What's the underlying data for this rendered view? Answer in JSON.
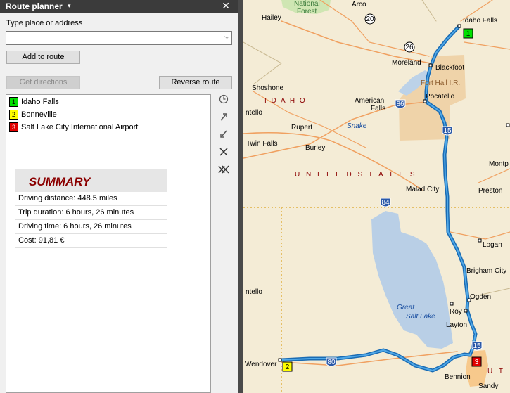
{
  "panel": {
    "title": "Route planner",
    "menu_arrow": "▾",
    "close_symbol": "✕",
    "place_label": "Type place or address",
    "place_value": "",
    "add_to_route_label": "Add to route",
    "get_directions_label": "Get directions",
    "reverse_route_label": "Reverse route"
  },
  "waypoints": [
    {
      "number": "1",
      "name": "Idaho Falls",
      "color": "#00e000"
    },
    {
      "number": "2",
      "name": "Bonneville",
      "color": "#ffff00"
    },
    {
      "number": "3",
      "name": "Salt Lake City International Airport",
      "color": "#e00000"
    }
  ],
  "summary": {
    "title": "SUMMARY",
    "driving_distance": "Driving distance:  448.5 miles",
    "trip_duration": "Trip duration:  6 hours, 26 minutes",
    "driving_time": "Driving time:  6 hours, 26 minutes",
    "cost": "Cost:  91,81 €"
  },
  "side_icons": [
    "clock-icon",
    "route-forward-icon",
    "route-back-icon",
    "scissors-icon",
    "double-scissors-icon"
  ],
  "map": {
    "labels": {
      "national_forest_1": "National",
      "national_forest_2": "Forest",
      "arco": "Arco",
      "hailey": "Hailey",
      "idaho_falls": "Idaho Falls",
      "moreland": "Moreland",
      "blackfoot": "Blackfoot",
      "fort_hall": "Fort Hall I.R.",
      "shoshone": "Shoshone",
      "idaho": "I D A H O",
      "american_falls_1": "American",
      "american_falls_2": "Falls",
      "pocatello": "Pocatello",
      "rupert": "Rupert",
      "snake": "Snake",
      "twin_falls": "Twin Falls",
      "burley": "Burley",
      "united_states": "U N I T E D   S T A T E S",
      "malad_city": "Malad City",
      "preston": "Preston",
      "mont": "Montp",
      "logan": "Logan",
      "brigham_city": "Brigham City",
      "ogden": "Ogden",
      "great_salt_lake_1": "Great",
      "great_salt_lake_2": "Salt Lake",
      "roy": "Roy",
      "layton": "Layton",
      "wendover": "Wendover",
      "bennion": "Bennion",
      "sandy": "Sandy",
      "ntello": "ntello",
      "ut": "U T",
      "road_20": "20",
      "road_26": "26",
      "i86": "86",
      "i15a": "15",
      "i84": "84",
      "i15b": "15",
      "i80": "80",
      "mk1": "1",
      "mk2": "2",
      "mk3": "3"
    }
  }
}
